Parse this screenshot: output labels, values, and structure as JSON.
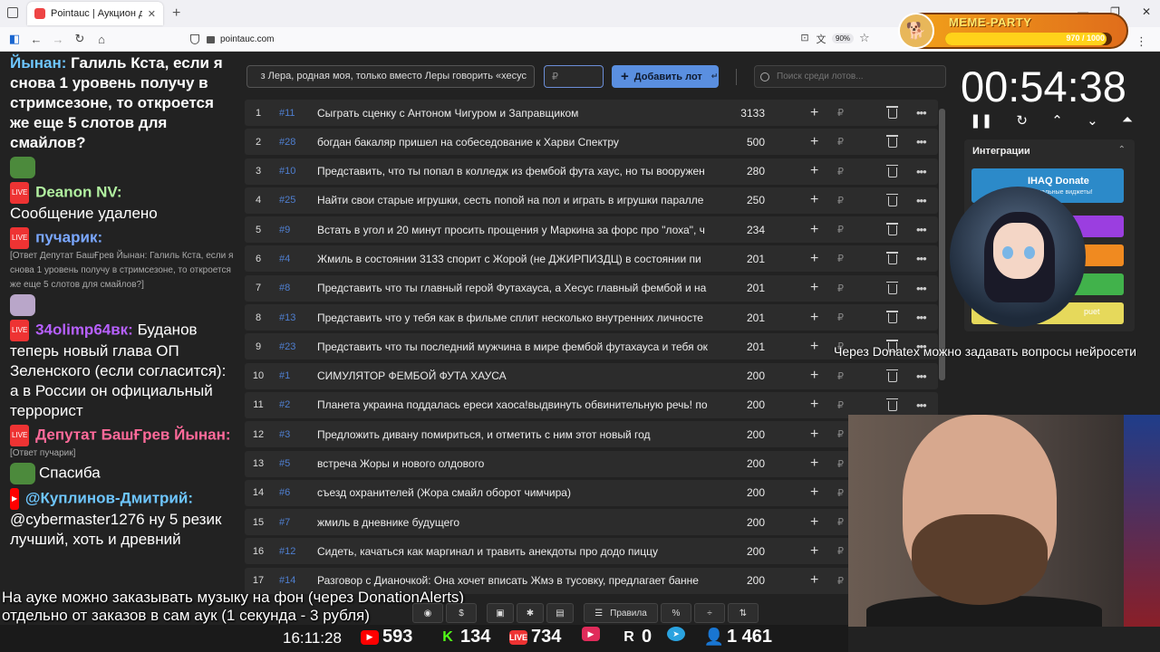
{
  "browser": {
    "tab_title": "Pointauc | Аукцион для стримс",
    "url": "pointauc.com",
    "zoom": "90%"
  },
  "meme_party": {
    "title": "MEME-PARTY",
    "progress_text": "970 / 1000",
    "progress": 0.97
  },
  "chat": {
    "messages": [
      {
        "nick": "Йынан:",
        "text": "Галиль Кста, если я снова 1 уровень получу в стримсезоне, то откроется же еще 5 слотов для смайлов?",
        "nick_color": "#6ec6ff"
      },
      {
        "nick": "Deanon NV:",
        "text": "Сообщение удалено",
        "nick_color": "#b1f0a0"
      },
      {
        "nick": "пучарик:",
        "quote": "[Ответ Депутат БашҒрев Йынан: Галиль Кста, если я снова 1 уровень получу в стримсезоне, то откроется же еще 5 слотов для смайлов?]",
        "nick_color": "#7aa7ff"
      },
      {
        "nick": "34olimp64вк:",
        "text": "Буданов теперь новый глава ОП Зеленского (если согласится): а в России он официальный террорист",
        "nick_color": "#b760ff"
      },
      {
        "nick": "Депутат БашҒрев Йынан:",
        "quote": "[Ответ пучарик]",
        "text": "Спасиба",
        "nick_color": "#ff6a9a"
      },
      {
        "nick": "@Куплинов-Дмитрий:",
        "text": "@cybermaster1276 ну 5 резик лучший, хоть и древний",
        "nick_color": "#6ec6ff"
      }
    ]
  },
  "toolbar": {
    "lot_input_value": "з Лера, родная моя, только вместо Леры говорить «хесус",
    "price_placeholder": "₽",
    "add_label": "Добавить лот",
    "search_placeholder": "Поиск среди лотов..."
  },
  "lots": [
    {
      "n": "1",
      "id": "#11",
      "name": "Сыграть сценку с Антоном Чигуром и Заправщиком",
      "amount": "3133"
    },
    {
      "n": "2",
      "id": "#28",
      "name": "богдан бакаляр пришел на собеседование к Харви Спектру",
      "amount": "500"
    },
    {
      "n": "3",
      "id": "#10",
      "name": "Представить, что ты попал в колледж из фембой фута хаус, но ты вооружен",
      "amount": "280"
    },
    {
      "n": "4",
      "id": "#25",
      "name": "Найти свои старые игрушки, сесть попой на пол и играть в игрушки паралле",
      "amount": "250"
    },
    {
      "n": "5",
      "id": "#9",
      "name": "Встать в угол и 20 минут просить прощения у Маркина за форс про \"лоха\", ч",
      "amount": "234"
    },
    {
      "n": "6",
      "id": "#4",
      "name": "Жмиль в состоянии 3133 спорит с Жорой (не ДЖИРПИЗДЦ) в состоянии пи",
      "amount": "201"
    },
    {
      "n": "7",
      "id": "#8",
      "name": "Представить что ты главный герой Футахауса, а Хесус главный фембой и на",
      "amount": "201"
    },
    {
      "n": "8",
      "id": "#13",
      "name": "Представить что у тебя как в фильме сплит несколько внутренних личносте",
      "amount": "201"
    },
    {
      "n": "9",
      "id": "#23",
      "name": "Представить что ты последний мужчина в мире фембой футахауса и тебя ок",
      "amount": "201"
    },
    {
      "n": "10",
      "id": "#1",
      "name": "СИМУЛЯТОР ФЕМБОЙ ФУТА ХАУСА",
      "amount": "200"
    },
    {
      "n": "11",
      "id": "#2",
      "name": "Планета украина поддалась ереси хаоса!выдвинуть обвинительную речь! по",
      "amount": "200"
    },
    {
      "n": "12",
      "id": "#3",
      "name": "Предложить дивану помириться, и отметить с ним этот новый год",
      "amount": "200"
    },
    {
      "n": "13",
      "id": "#5",
      "name": "встреча Жоры и нового олдового",
      "amount": "200"
    },
    {
      "n": "14",
      "id": "#6",
      "name": "съезд охранителей (Жора смайл оборот чимчира)",
      "amount": "200"
    },
    {
      "n": "15",
      "id": "#7",
      "name": "жмиль в дневнике будущего",
      "amount": "200"
    },
    {
      "n": "16",
      "id": "#12",
      "name": "Сидеть, качаться как маргинал и травить анекдоты про додо пиццу",
      "amount": "200"
    },
    {
      "n": "17",
      "id": "#14",
      "name": "Разговор с Дианочкой: Она хочет вписать Жмэ в тусовку, предлагает банне",
      "amount": "200"
    }
  ],
  "currency_symbol": "₽",
  "timer": "00:54:38",
  "integrations": {
    "title": "Интеграции",
    "donate_title": "IHAQ Donate",
    "donate_sub": "Уникальные виджеты!",
    "d5_label": "puet"
  },
  "overlays": {
    "right_text": "Через Donatex можно задавать вопросы нейросети",
    "bottom_line1": "На ауке можно заказывать музыку на фон (через DonationAlerts)",
    "bottom_line2": "отдельно от заказов в сам аук (1 секунда - 3 рубля)"
  },
  "bottom_toolbar": {
    "rules_label": "Правила"
  },
  "stats": {
    "clock": "16:11:28",
    "youtube": "593",
    "kick": "134",
    "vk": "734",
    "rutube": "0",
    "telegram": "1 461"
  }
}
